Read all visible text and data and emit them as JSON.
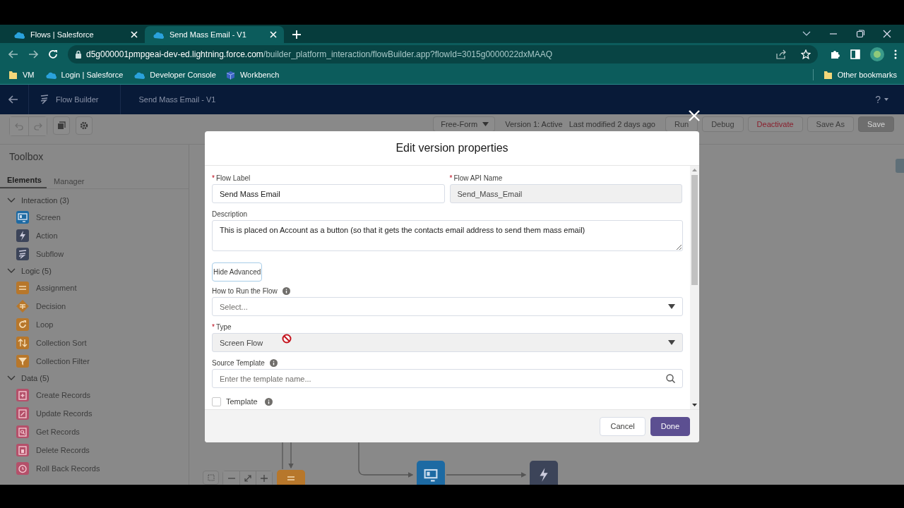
{
  "browser": {
    "tabs": [
      {
        "title": "Flows | Salesforce",
        "selected": false
      },
      {
        "title": "Send Mass Email - V1",
        "selected": true
      }
    ],
    "address": {
      "host": "d5g000001pmpgeai-dev-ed.lightning.force.com",
      "path": "/builder_platform_interaction/flowBuilder.app?flowId=3015g0000022dxMAAQ"
    },
    "bookmarks": [
      {
        "label": "VM",
        "kind": "folder"
      },
      {
        "label": "Login | Salesforce",
        "kind": "cloud"
      },
      {
        "label": "Developer Console",
        "kind": "cloud"
      },
      {
        "label": "Workbench",
        "kind": "cube"
      }
    ],
    "other_bookmarks": "Other bookmarks"
  },
  "app_header": {
    "app_name": "Flow Builder",
    "flow_name": "Send Mass Email - V1",
    "help": "?"
  },
  "toolbar": {
    "canvas_mode": "Free-Form",
    "status": "Version 1: Active   Last modified 2 days ago",
    "buttons": [
      {
        "label": "Run",
        "kind": "neutral",
        "disabled": false
      },
      {
        "label": "Debug",
        "kind": "neutral",
        "disabled": false
      },
      {
        "label": "Deactivate",
        "kind": "destructive",
        "disabled": false
      },
      {
        "label": "Save As",
        "kind": "neutral",
        "disabled": false
      },
      {
        "label": "Save",
        "kind": "brand",
        "disabled": true
      }
    ]
  },
  "toolbox": {
    "title": "Toolbox",
    "tabs": [
      {
        "label": "Elements",
        "selected": true
      },
      {
        "label": "Manager",
        "selected": false
      }
    ],
    "sections": [
      {
        "label": "Interaction (3)",
        "expanded": true,
        "items": [
          {
            "label": "Screen",
            "kind": "screen",
            "color": "#1d6aa3"
          },
          {
            "label": "Action",
            "kind": "action",
            "color": "#3c4459"
          },
          {
            "label": "Subflow",
            "kind": "subflow",
            "color": "#3c4459"
          }
        ]
      },
      {
        "label": "Logic (5)",
        "expanded": true,
        "items": [
          {
            "label": "Assignment",
            "kind": "assignment",
            "color": "#b7772b"
          },
          {
            "label": "Decision",
            "kind": "decision",
            "color": "#b7772b"
          },
          {
            "label": "Loop",
            "kind": "loop",
            "color": "#b7772b"
          },
          {
            "label": "Collection Sort",
            "kind": "sort",
            "color": "#b7772b"
          },
          {
            "label": "Collection Filter",
            "kind": "filter",
            "color": "#b7772b"
          }
        ]
      },
      {
        "label": "Data (5)",
        "expanded": true,
        "items": [
          {
            "label": "Create Records",
            "kind": "create",
            "color": "#b4506a"
          },
          {
            "label": "Update Records",
            "kind": "update",
            "color": "#b4506a"
          },
          {
            "label": "Get Records",
            "kind": "get",
            "color": "#b4506a"
          },
          {
            "label": "Delete Records",
            "kind": "delete",
            "color": "#b4506a"
          },
          {
            "label": "Roll Back Records",
            "kind": "rollback",
            "color": "#b4506a"
          }
        ]
      }
    ]
  },
  "canvas": {
    "nodes": [
      {
        "kind": "assignment"
      },
      {
        "kind": "screen"
      },
      {
        "kind": "action"
      }
    ]
  },
  "modal": {
    "title": "Edit version properties",
    "fields": [
      {
        "kind": "text",
        "label": "Flow Label",
        "required_mark": "*",
        "value": "Send Mass Email",
        "disabled": false,
        "half": true,
        "info": false
      },
      {
        "kind": "text",
        "label": "Flow API Name",
        "required_mark": "*",
        "value": "Send_Mass_Email",
        "disabled": true,
        "half": true,
        "info": false
      },
      {
        "kind": "textarea",
        "label": "Description",
        "value": "This is placed on Account as a button (so that it gets the contacts email address to send them mass email)",
        "disabled": false
      },
      {
        "kind": "toggle",
        "label": "Hide Advanced"
      },
      {
        "kind": "combobox",
        "label": "How to Run the Flow",
        "info": true,
        "placeholder": "Select...",
        "disabled": false
      },
      {
        "kind": "combobox",
        "label": "Type",
        "required_mark": "*",
        "value": "Screen Flow",
        "disabled": true
      },
      {
        "kind": "search",
        "label": "Source Template",
        "info": true,
        "placeholder": "Enter the template name...",
        "disabled": false
      },
      {
        "kind": "checkbox",
        "label": "Template",
        "info": true,
        "checked": false
      }
    ],
    "buttons": [
      {
        "label": "Cancel",
        "kind": "neutral"
      },
      {
        "label": "Done",
        "kind": "brand"
      }
    ]
  }
}
